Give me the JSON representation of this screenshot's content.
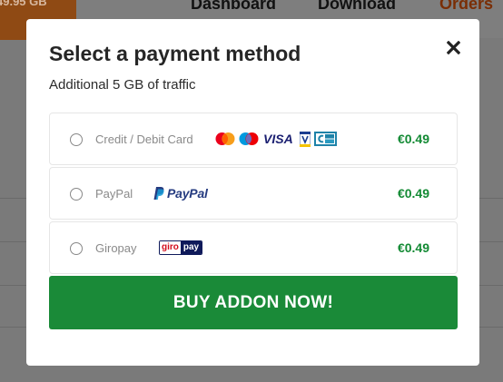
{
  "background": {
    "balance": "49.95 GB",
    "nav": [
      "Dashboard",
      "Download",
      "Orders"
    ]
  },
  "modal": {
    "title": "Select a payment method",
    "subtitle": "Additional 5 GB of traffic",
    "options": [
      {
        "label": "Credit / Debit Card",
        "price": "€0.49",
        "logos": [
          "mastercard-icon",
          "maestro-icon",
          "visa-icon",
          "vpay-icon",
          "cartes-bancaires-icon"
        ]
      },
      {
        "label": "PayPal",
        "price": "€0.49",
        "logos": [
          "paypal-logo"
        ],
        "logo_text": "PayPal"
      },
      {
        "label": "Giropay",
        "price": "€0.49",
        "logos": [
          "giropay-logo"
        ],
        "logo_text": [
          "giro",
          "pay"
        ]
      }
    ],
    "buy_button": "BUY ADDON NOW!",
    "close_icon": "close-icon"
  },
  "colors": {
    "price": "#138a34",
    "button": "#1a8a38",
    "paypal_dark": "#253b80",
    "paypal_light": "#179bd7"
  }
}
